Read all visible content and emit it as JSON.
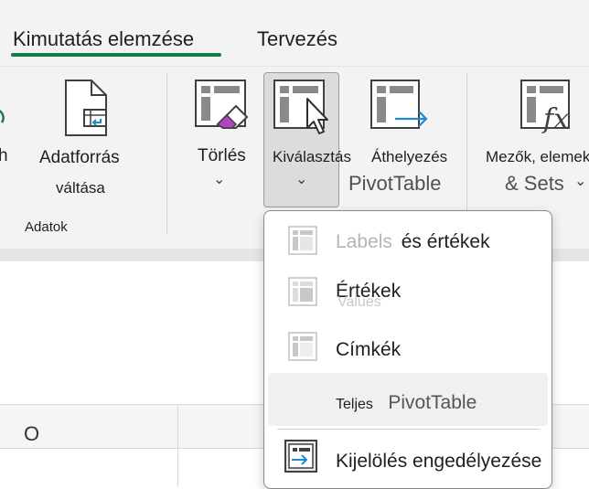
{
  "tabs": [
    {
      "label": "Kimutatás elemzése",
      "active": true
    },
    {
      "label": "Tervezés",
      "active": false
    }
  ],
  "ribbon": {
    "left_partial_text": "h",
    "data_group": {
      "label": "Adatok",
      "button_line1": "Adatforrás",
      "button_line2": "váltása"
    },
    "actions": {
      "clear_label": "Törlés",
      "select_label": "Kiválasztás",
      "move_label_line1": "Áthelyezés",
      "move_label_line2": "PivotTable"
    },
    "fields": {
      "label_line1": "Mezők, elemek",
      "label_line2": "& Sets"
    },
    "chevron": "⌄",
    "chevron_right": "⌄"
  },
  "menu": {
    "items": [
      {
        "label_ghost": "Labels",
        "label": "és értékek",
        "disabled": false
      },
      {
        "label": "Értékek",
        "ghost_under": "Values"
      },
      {
        "label": "Címkék"
      },
      {
        "label_prefix": "Teljes",
        "label": "PivotTable",
        "highlighted": true
      },
      {
        "label": "Kijelölés engedélyezése"
      }
    ]
  },
  "sheet": {
    "column_label": "O"
  },
  "colors": {
    "accent": "#107c41",
    "erase_pink": "#b146c2",
    "arrow_blue": "#1e8bcd"
  }
}
